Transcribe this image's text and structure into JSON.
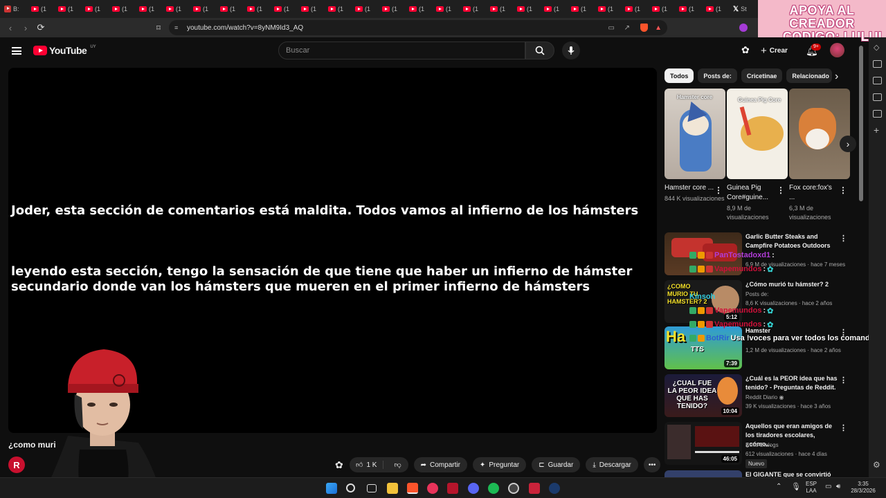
{
  "browser": {
    "tab_first_label": "B:",
    "tab_label": "(1",
    "tab_last_label": "St",
    "url": "youtube.com/watch?v=8yNM9Id3_AQ"
  },
  "promo": {
    "line1": "APOYA AL CREADOR",
    "line2": "CODIGO: LULUI"
  },
  "youtube": {
    "logo": "YouTube",
    "country": "UY",
    "search_placeholder": "Buscar",
    "create_label": "Crear",
    "notifications": "9+"
  },
  "video": {
    "subtitle1": "Joder, esta sección de comentarios está maldita. Todos vamos al infierno de los hámsters",
    "subtitle2_line1": "leyendo esta sección, tengo la sensación de que tiene que haber un infierno de hámster",
    "subtitle2_line2": "secundario donde van los hámsters que mueren en el primer infierno de hámsters",
    "title": "¿como muri",
    "likes": "1 K",
    "share": "Compartir",
    "ask": "Preguntar",
    "save": "Guardar",
    "download": "Descargar"
  },
  "chips": [
    "Todos",
    "Posts de:",
    "Cricetinae",
    "Relacionado"
  ],
  "shorts": [
    {
      "title": "Hamster core ...",
      "views": "844 K visualizaciones",
      "overlay": "Hamster core"
    },
    {
      "title": "Guinea Pig Core#guine...",
      "views": "8,9 M de visualizaciones",
      "overlay": "Guinea Pig Core"
    },
    {
      "title": "Fox core:fox's ...",
      "views": "6,3 M de visualizaciones",
      "overlay": ""
    }
  ],
  "recommended": [
    {
      "title": "Garlic Butter Steaks and Campfire Potatoes Outdoors",
      "channel": "",
      "views": "6,9 M de visualizaciones · hace 7 meses",
      "duration": ""
    },
    {
      "title": "¿Cómo murió tu hámster? 2",
      "channel": "Posts de:",
      "views": "8,6 K visualizaciones · hace 2 años",
      "duration": "5:12",
      "thumb_text": "¿COMO MURIO TU HAMSTER? 2"
    },
    {
      "title": "Hamster",
      "channel": "",
      "views": "1,2 M de visualizaciones · hace 2 años",
      "duration": "7:39",
      "thumb_text": "TTS"
    },
    {
      "title": "¿Cuál es la PEOR idea que has tenido? - Preguntas de Reddit.",
      "channel": "Reddit Diario",
      "views": "39 K visualizaciones · hace 3 años",
      "duration": "10:04",
      "thumb_text": "¿CUAL FUE LA PEOR IDEA QUE HAS TENIDO?"
    },
    {
      "title": "Aquellos que eran amigos de los tiradores escolares, ¿cómo...",
      "channel": "Neko Dialogs",
      "views": "612 visualizaciones · hace 4 días",
      "duration": "46:05",
      "badge": "Nuevo"
    },
    {
      "title": "El GIGANTE que se convirtió en...",
      "channel": "",
      "views": "",
      "duration": ""
    }
  ],
  "chat": [
    {
      "user": "PanTostadoxd1",
      "msg": ":"
    },
    {
      "user": "Vapemundos",
      "msg": ":"
    },
    {
      "user": "Kinsoh",
      "msg": ""
    },
    {
      "user": "Vapemundos",
      "msg": ":"
    },
    {
      "user": "Vapemundos",
      "msg": ":"
    },
    {
      "user": "BotRir",
      "msg": "Usa !voces para ver todos los comandos del"
    }
  ],
  "taskbar": {
    "lang1": "ESP",
    "lang2": "LAA",
    "time": "3:35",
    "date": "28/3/2026"
  },
  "colors": {
    "accent": "#ff0033",
    "chat_name": "#c03bd6",
    "promo_bg": "#f4b9c9"
  }
}
